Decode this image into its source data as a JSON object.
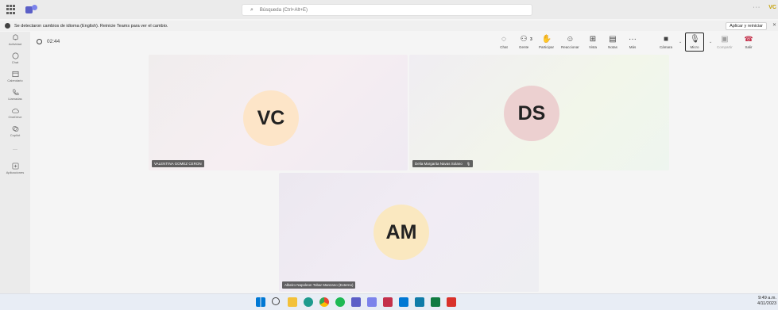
{
  "titlebar": {
    "search_placeholder": "Búsqueda (Ctrl+Alt+E)",
    "more": "···",
    "user_initials": "VC"
  },
  "notification": {
    "message": "Se detectaron cambios de idioma (English). Reinicie Teams para ver el cambio.",
    "apply_label": "Aplicar y reiniciar",
    "close": "✕"
  },
  "rail": {
    "items": [
      {
        "label": "Actividad",
        "icon": "bell-icon"
      },
      {
        "label": "Chat",
        "icon": "chat-icon"
      },
      {
        "label": "Calendario",
        "icon": "calendar-icon"
      },
      {
        "label": "Llamadas",
        "icon": "phone-icon"
      },
      {
        "label": "OneDrive",
        "icon": "cloud-icon"
      },
      {
        "label": "Copilot",
        "icon": "copilot-icon"
      },
      {
        "label": "···",
        "icon": "more-icon"
      },
      {
        "label": "Aplicaciones",
        "icon": "apps-plus-icon"
      }
    ]
  },
  "meeting": {
    "timer": "02:44",
    "controls": {
      "chat": "Chat",
      "people": "Gente",
      "people_count": "3",
      "raise": "Participar",
      "react": "Reaccionar",
      "view": "Vista",
      "notes": "Notas",
      "more": "Más",
      "camera": "Cámara",
      "mic": "Micro",
      "share": "Compartir",
      "leave": "Salir"
    }
  },
  "participants": [
    {
      "initials": "VC",
      "name": "VALENTINA GOMEZ CERON",
      "muted": false,
      "avatar_color": "#fde5c8"
    },
    {
      "initials": "DS",
      "name": "Delia Margarita Navas Solano",
      "muted": true,
      "avatar_color": "#ecd0d0"
    },
    {
      "initials": "AM",
      "name": "Albeiro Napoleon Tobar Manzano (Externo)",
      "muted": false,
      "avatar_color": "#fae8c0"
    }
  ],
  "taskbar": {
    "time": "9:49 a.m.",
    "date": "4/11/2023"
  }
}
